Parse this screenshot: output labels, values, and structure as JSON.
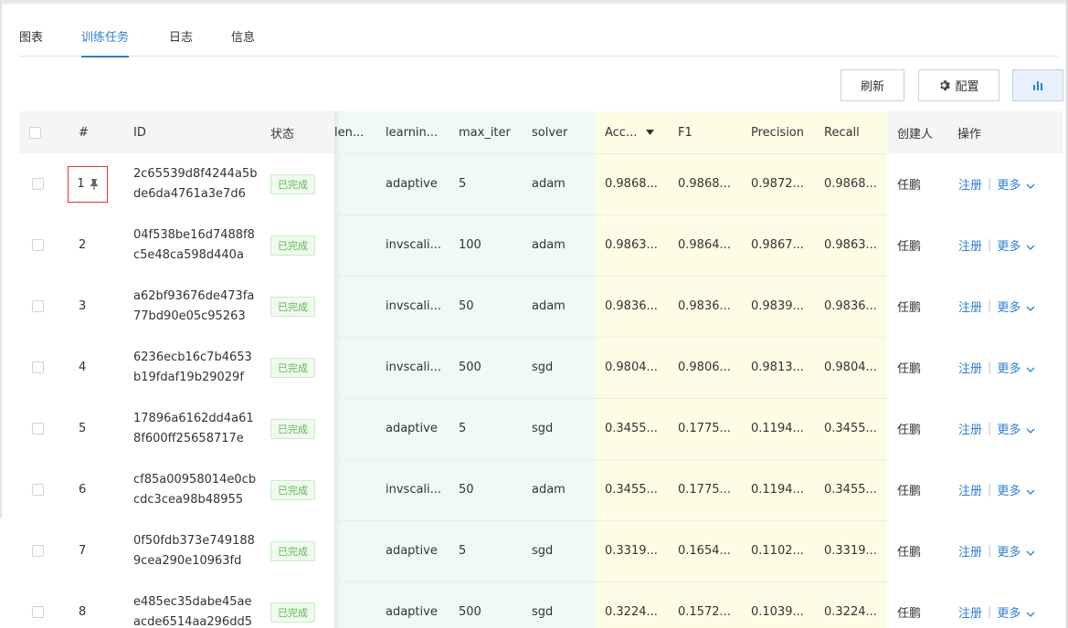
{
  "tabs": [
    {
      "label": "图表",
      "active": false
    },
    {
      "label": "训练任务",
      "active": true
    },
    {
      "label": "日志",
      "active": false
    },
    {
      "label": "信息",
      "active": false
    }
  ],
  "toolbar": {
    "refresh_label": "刷新",
    "config_label": "配置",
    "chart_icon": "bar-chart-icon",
    "config_icon": "gear-icon"
  },
  "table": {
    "headers": {
      "index": "#",
      "id": "ID",
      "status": "状态",
      "len": "len...",
      "learning": "learnin...",
      "max_iter": "max_iter",
      "solver": "solver",
      "accuracy": "Acc...",
      "f1": "F1",
      "precision": "Precision",
      "recall": "Recall",
      "creator": "创建人",
      "actions": "操作"
    },
    "sort_icon": "sort-desc-icon",
    "rows": [
      {
        "index": "1",
        "id": "2c65539d8f4244a5bde6da4761a3e7d6",
        "status": "已完成",
        "learning": "adaptive",
        "max_iter": "5",
        "solver": "adam",
        "accuracy": "0.9868...",
        "f1": "0.9868...",
        "precision": "0.9872...",
        "recall": "0.9868...",
        "creator": "任鹏",
        "register": "注册",
        "more": "更多",
        "pinned": true
      },
      {
        "index": "2",
        "id": "04f538be16d7488f8c5e48ca598d440a",
        "status": "已完成",
        "learning": "invscali...",
        "max_iter": "100",
        "solver": "adam",
        "accuracy": "0.9863...",
        "f1": "0.9864...",
        "precision": "0.9867...",
        "recall": "0.9863...",
        "creator": "任鹏",
        "register": "注册",
        "more": "更多",
        "pinned": false
      },
      {
        "index": "3",
        "id": "a62bf93676de473fa77bd90e05c95263",
        "status": "已完成",
        "learning": "invscali...",
        "max_iter": "50",
        "solver": "adam",
        "accuracy": "0.9836...",
        "f1": "0.9836...",
        "precision": "0.9839...",
        "recall": "0.9836...",
        "creator": "任鹏",
        "register": "注册",
        "more": "更多",
        "pinned": false
      },
      {
        "index": "4",
        "id": "6236ecb16c7b4653b19fdaf19b29029f",
        "status": "已完成",
        "learning": "invscali...",
        "max_iter": "500",
        "solver": "sgd",
        "accuracy": "0.9804...",
        "f1": "0.9806...",
        "precision": "0.9813...",
        "recall": "0.9804...",
        "creator": "任鹏",
        "register": "注册",
        "more": "更多",
        "pinned": false
      },
      {
        "index": "5",
        "id": "17896a6162dd4a618f600ff25658717e",
        "status": "已完成",
        "learning": "adaptive",
        "max_iter": "5",
        "solver": "sgd",
        "accuracy": "0.3455...",
        "f1": "0.1775...",
        "precision": "0.1194...",
        "recall": "0.3455...",
        "creator": "任鹏",
        "register": "注册",
        "more": "更多",
        "pinned": false
      },
      {
        "index": "6",
        "id": "cf85a00958014e0cbcdc3cea98b48955",
        "status": "已完成",
        "learning": "invscali...",
        "max_iter": "50",
        "solver": "adam",
        "accuracy": "0.3455...",
        "f1": "0.1775...",
        "precision": "0.1194...",
        "recall": "0.3455...",
        "creator": "任鹏",
        "register": "注册",
        "more": "更多",
        "pinned": false
      },
      {
        "index": "7",
        "id": "0f50fdb373e7491889cea290e10963fd",
        "status": "已完成",
        "learning": "adaptive",
        "max_iter": "5",
        "solver": "sgd",
        "accuracy": "0.3319...",
        "f1": "0.1654...",
        "precision": "0.1102...",
        "recall": "0.3319...",
        "creator": "任鹏",
        "register": "注册",
        "more": "更多",
        "pinned": false
      },
      {
        "index": "8",
        "id": "e485ec35dabe45aeacde6514aa296dd5",
        "status": "已完成",
        "learning": "adaptive",
        "max_iter": "500",
        "solver": "sgd",
        "accuracy": "0.3224...",
        "f1": "0.1572...",
        "precision": "0.1039...",
        "recall": "0.3224...",
        "creator": "任鹏",
        "register": "注册",
        "more": "更多",
        "pinned": false
      }
    ]
  },
  "colors": {
    "accent": "#2d7fd2",
    "param_column_bg": "#eefaf3",
    "metric_column_bg": "#fdfde5",
    "header_bg": "#f5f5f5",
    "status_green": "#5aba4f"
  }
}
